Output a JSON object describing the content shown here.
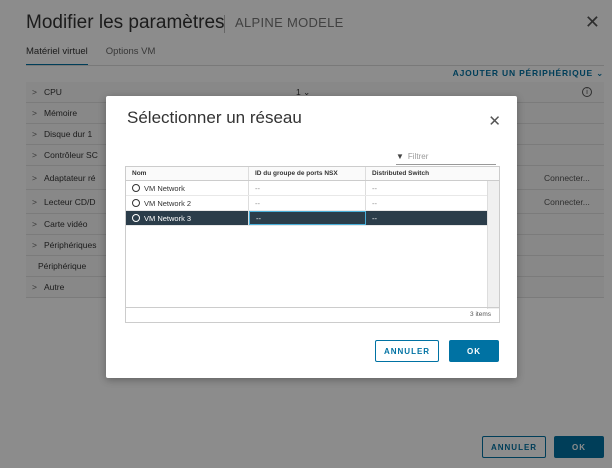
{
  "background": {
    "title": "Modifier les paramètres",
    "subtitle": "ALPINE MODELE",
    "close_label": "✕",
    "tabs": [
      {
        "label": "Matériel virtuel",
        "active": true
      },
      {
        "label": "Options VM",
        "active": false
      }
    ],
    "add_device_label": "AJOUTER UN PÉRIPHÉRIQUE ⌄",
    "hardware": [
      {
        "label": "CPU",
        "chevron": ">",
        "value": "1  ⌄"
      },
      {
        "label": "Mémoire",
        "chevron": ">"
      },
      {
        "label": "Disque dur 1",
        "chevron": ">"
      },
      {
        "label": "Contrôleur SC",
        "chevron": ">"
      },
      {
        "label": "Adaptateur ré",
        "chevron": ">",
        "status": "Connecter..."
      },
      {
        "label": "Lecteur CD/D",
        "chevron": ">",
        "status": "Connecter..."
      },
      {
        "label": "Carte vidéo",
        "chevron": ">"
      },
      {
        "label": "Périphériques",
        "chevron": ">"
      },
      {
        "label": "Périphérique",
        "chevron": ""
      },
      {
        "label": "Autre",
        "chevron": ">"
      }
    ],
    "cancel_label": "ANNULER",
    "ok_label": "OK"
  },
  "modal": {
    "title": "Sélectionner un réseau",
    "close_label": "✕",
    "filter_placeholder": "Filtrer",
    "columns": [
      "Nom",
      "ID du groupe de ports NSX",
      "Distributed Switch"
    ],
    "rows": [
      {
        "name": "VM Network",
        "nsx": "--",
        "switch": "--",
        "selected": false
      },
      {
        "name": "VM Network 2",
        "nsx": "--",
        "switch": "--",
        "selected": false
      },
      {
        "name": "VM Network 3",
        "nsx": "--",
        "switch": "--",
        "selected": true
      }
    ],
    "item_count": "3 items",
    "cancel_label": "ANNULER",
    "ok_label": "OK"
  },
  "colors": {
    "accent": "#0072a3",
    "selected_row": "#2b3d4a"
  }
}
